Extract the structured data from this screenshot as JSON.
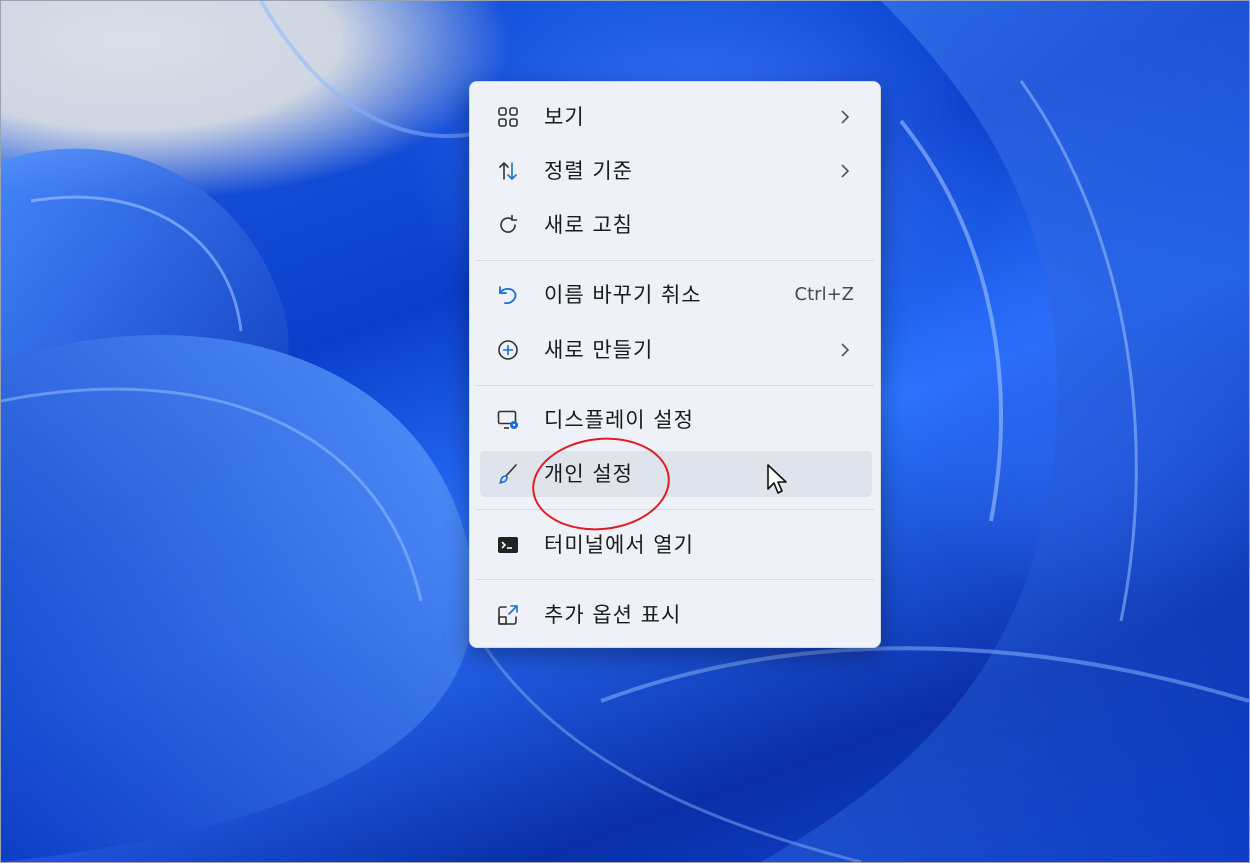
{
  "menu": {
    "items": [
      {
        "id": "view",
        "label": "보기",
        "icon": "view-grid-icon",
        "submenu": true
      },
      {
        "id": "sort",
        "label": "정렬 기준",
        "icon": "sort-arrows-icon",
        "submenu": true
      },
      {
        "id": "refresh",
        "label": "새로 고침",
        "icon": "refresh-icon"
      },
      {
        "id": "undo-rename",
        "label": "이름 바꾸기 취소",
        "icon": "undo-icon",
        "shortcut": "Ctrl+Z"
      },
      {
        "id": "new",
        "label": "새로 만들기",
        "icon": "plus-circle-icon",
        "submenu": true
      },
      {
        "id": "display-settings",
        "label": "디스플레이 설정",
        "icon": "display-settings-icon"
      },
      {
        "id": "personalize",
        "label": "개인 설정",
        "icon": "brush-icon",
        "hovered": true
      },
      {
        "id": "open-terminal",
        "label": "터미널에서 열기",
        "icon": "terminal-icon"
      },
      {
        "id": "more-options",
        "label": "추가 옵션 표시",
        "icon": "more-options-icon"
      }
    ]
  },
  "annotation": {
    "highlight_color": "#e01c24",
    "target": "개인 설정"
  },
  "colors": {
    "menu_bg": "#eef1f8",
    "hover_bg": "#dfe3ec",
    "accent_blue": "#1a6fd6"
  }
}
